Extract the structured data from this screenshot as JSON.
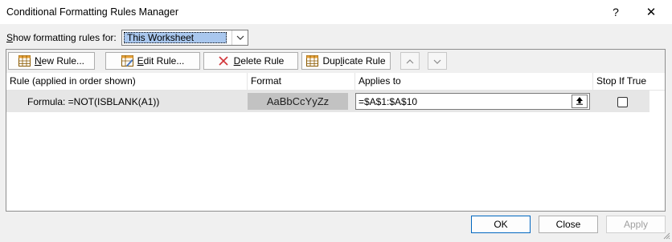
{
  "window": {
    "title": "Conditional Formatting Rules Manager",
    "help_glyph": "?",
    "close_glyph": "✕"
  },
  "scope": {
    "label_accel": "S",
    "label_rest": "how formatting rules for:",
    "selected": "This Worksheet"
  },
  "toolbar": {
    "new_rule": {
      "accel": "N",
      "rest": "ew Rule..."
    },
    "edit_rule": {
      "accel": "E",
      "rest": "dit Rule..."
    },
    "delete_rule": {
      "accel": "D",
      "rest": "elete Rule"
    },
    "duplicate_rule": {
      "pre": "Dup",
      "accel": "l",
      "rest": "icate Rule"
    }
  },
  "table": {
    "headers": [
      "Rule (applied in order shown)",
      "Format",
      "Applies to",
      "Stop If True"
    ],
    "rows": [
      {
        "rule": "Formula: =NOT(ISBLANK(A1))",
        "format_preview": "AaBbCcYyZz",
        "applies_to": "=$A$1:$A$10",
        "stop_if_true": false
      }
    ]
  },
  "buttons": {
    "ok": "OK",
    "close": "Close",
    "apply": "Apply"
  },
  "icons": {
    "new_rule": "table-grid-icon",
    "edit_rule": "edit-table-icon",
    "delete_rule": "red-x-icon",
    "duplicate_rule": "duplicate-table-icon",
    "move_up": "chevron-up-icon",
    "move_down": "chevron-down-icon",
    "collapse": "collapse-dialog-icon"
  },
  "colors": {
    "accent": "#0067c0",
    "selection": "#a9c7ee",
    "delete_icon": "#d13438"
  }
}
